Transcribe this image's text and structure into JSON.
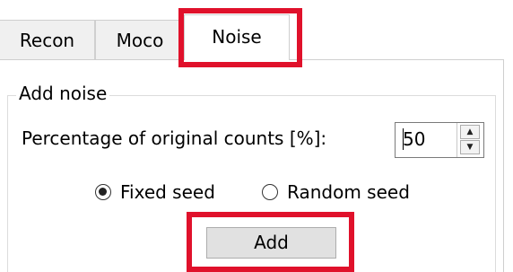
{
  "tabs": [
    {
      "label": "Recon",
      "active": false
    },
    {
      "label": "Moco",
      "active": false
    },
    {
      "label": "Noise",
      "active": true
    }
  ],
  "group": {
    "title": "Add noise"
  },
  "percentage": {
    "label": "Percentage of original counts [%]:",
    "value": "50"
  },
  "seed": {
    "fixed_label": "Fixed seed",
    "random_label": "Random seed",
    "selected": "fixed"
  },
  "add_button": {
    "label": "Add"
  },
  "colors": {
    "highlight": "#e0112b",
    "tab_bg": "#f0f0f0",
    "button_bg": "#e1e1e1"
  }
}
